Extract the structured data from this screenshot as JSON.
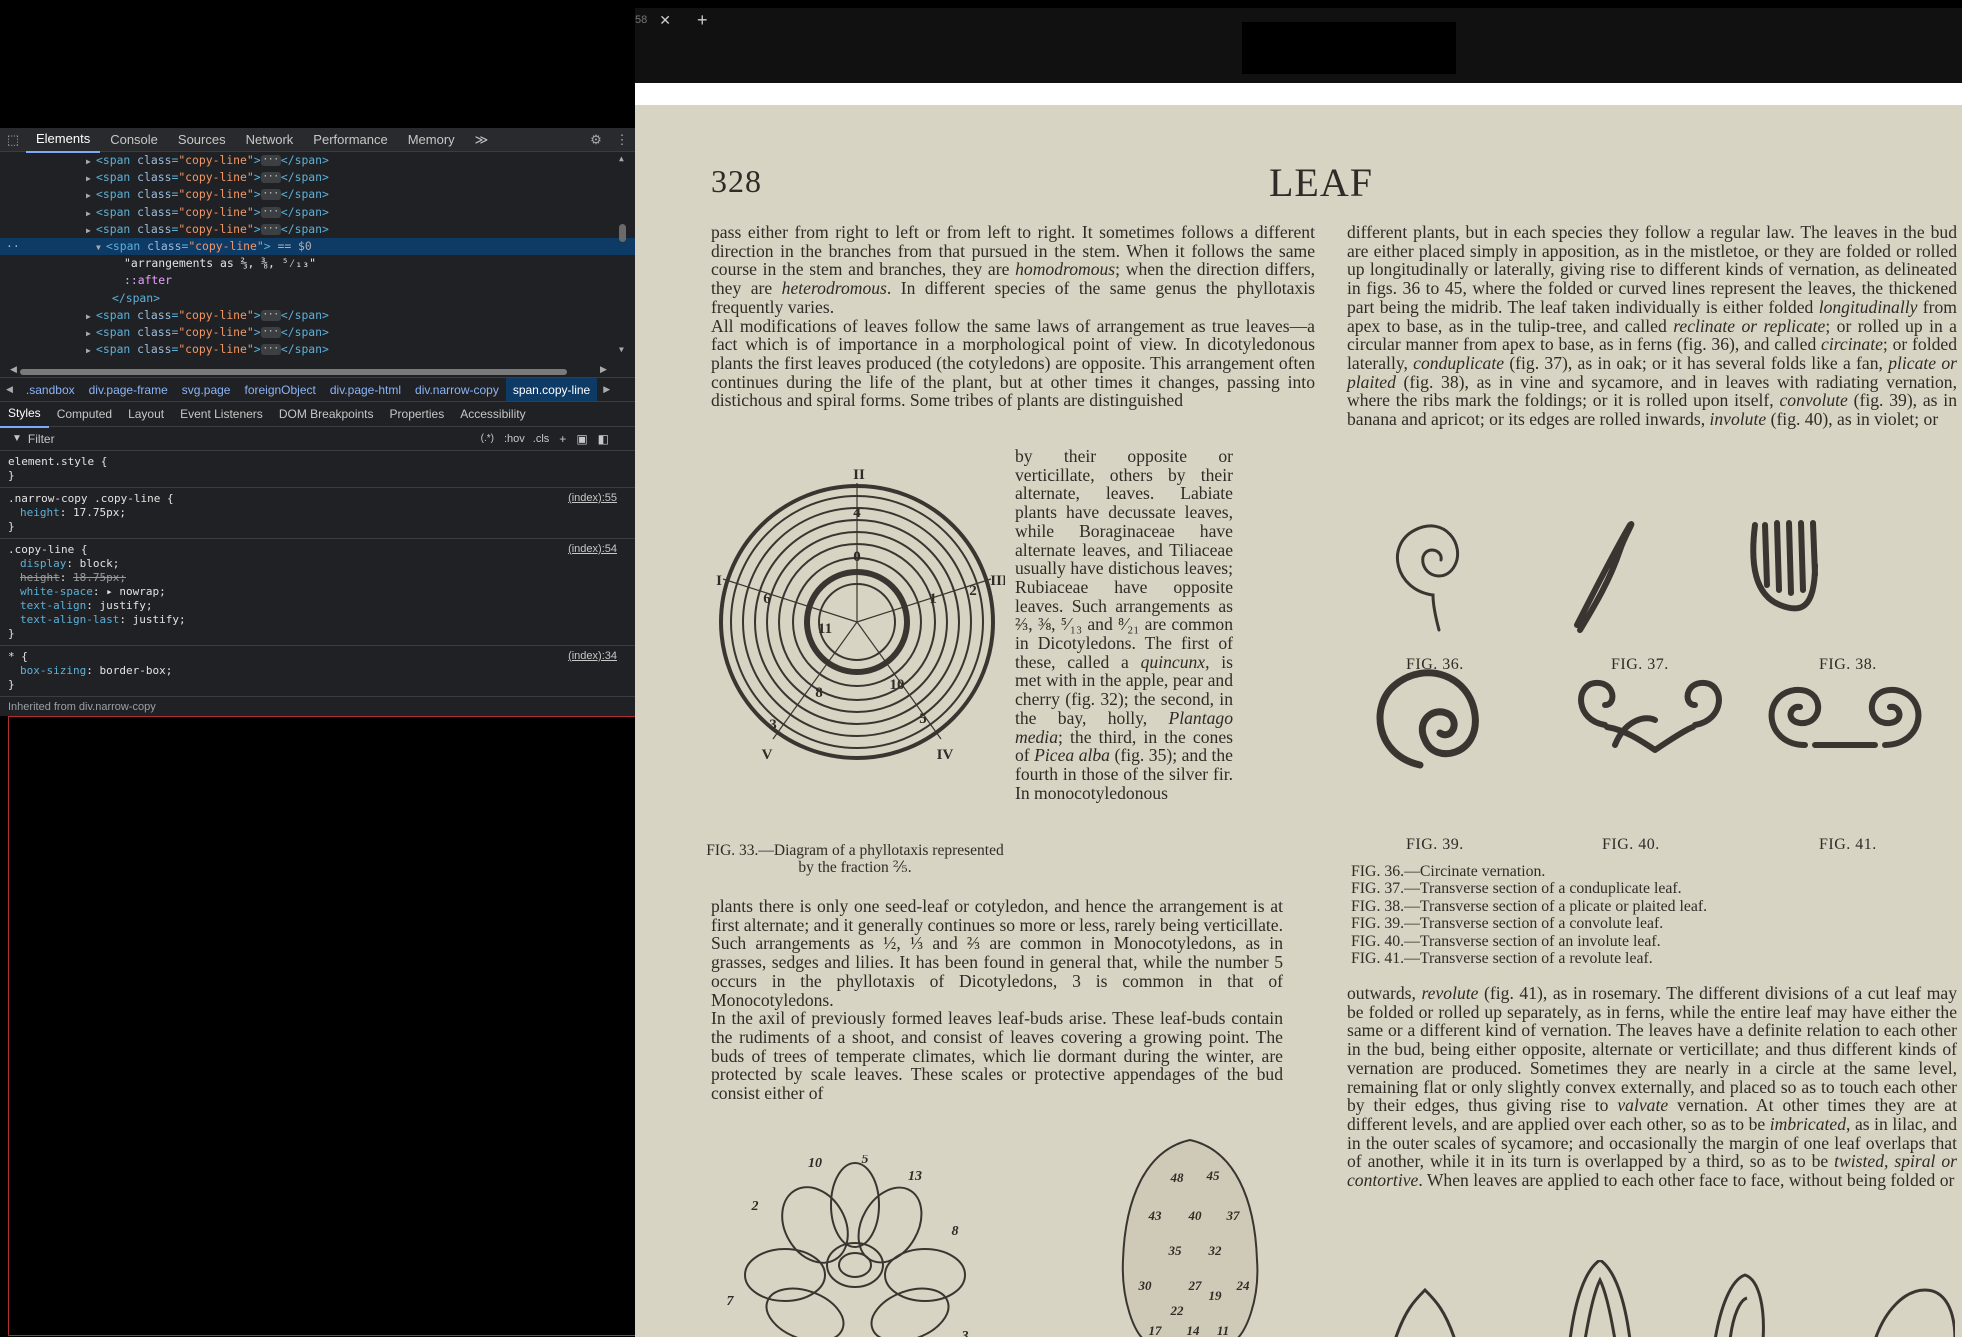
{
  "devtools": {
    "tabs": [
      "Elements",
      "Console",
      "Sources",
      "Network",
      "Performance",
      "Memory"
    ],
    "more_tabs": "≫",
    "dom_lines": [
      {
        "kind": "collapsed",
        "open": "<span class=\"copy-line\">",
        "close": "</span>"
      },
      {
        "kind": "collapsed",
        "open": "<span class=\"copy-line\">",
        "close": "</span>"
      },
      {
        "kind": "collapsed",
        "open": "<span class=\"copy-line\">",
        "close": "</span>"
      },
      {
        "kind": "collapsed",
        "open": "<span class=\"copy-line\">",
        "close": "</span>"
      },
      {
        "kind": "collapsed",
        "open": "<span class=\"copy-line\">",
        "close": "</span>"
      }
    ],
    "selected_line": {
      "tag": "span",
      "attr": "class",
      "value": "copy-line",
      "marker": "== $0"
    },
    "selected_text": "\"arrangements as ⅔, ⅜, ⁵⁄₁₃\"",
    "after_pseudo": "::after",
    "close_span": "</span>",
    "tag_name": "span",
    "attr_name": "class",
    "attr_value": "copy-line",
    "breadcrumbs": [
      ".sandbox",
      "div.page-frame",
      "svg.page",
      "foreignObject",
      "div.page-html",
      "div.narrow-copy",
      "span.copy-line"
    ],
    "subtabs": [
      "Styles",
      "Computed",
      "Layout",
      "Event Listeners",
      "DOM Breakpoints",
      "Properties",
      "Accessibility"
    ],
    "filter_placeholder": "Filter",
    "filter_tools": [
      ":hov",
      ".cls"
    ],
    "rules": [
      {
        "selector": "element.style {",
        "source": "",
        "props": []
      },
      {
        "selector": ".narrow-copy .copy-line {",
        "source": "(index):55",
        "props": [
          {
            "name": "height",
            "value": "17.75px;",
            "struck": false
          }
        ]
      },
      {
        "selector": ".copy-line {",
        "source": "(index):54",
        "props": [
          {
            "name": "display",
            "value": "block;",
            "struck": false
          },
          {
            "name": "height",
            "value": "18.75px;",
            "struck": true
          },
          {
            "name": "white-space",
            "value": "▸ nowrap;",
            "struck": false
          },
          {
            "name": "text-align",
            "value": "justify;",
            "struck": false
          },
          {
            "name": "text-align-last",
            "value": "justify;",
            "struck": false
          }
        ]
      },
      {
        "selector": "* {",
        "source": "(index):34",
        "props": [
          {
            "name": "box-sizing",
            "value": "border-box;",
            "struck": false
          }
        ]
      }
    ],
    "inherited_text": "Inherited from div.narrow-copy"
  },
  "browser": {
    "tab_fragment": "58",
    "close_glyph": "✕",
    "new_tab_glyph": "+"
  },
  "page": {
    "number": "328",
    "title": "LEAF",
    "left_col_1": [
      "pass either from right to left or from left to right. It sometimes follows a different direction in the branches from that pursued in the stem. When it follows the same course in the stem and branches, they are <i>homodromous</i>; when the direction differs, they are <i>heterodromous</i>. In different species of the same genus the phyllotaxis frequently varies.",
      "All modifications of leaves follow the same laws of arrangement as true leaves—a fact which is of importance in a morphological point of view. In dicotyledonous plants the first leaves produced (the cotyledons) are opposite. This arrangement often continues during the life of the plant, but at other times it changes, passing into distichous and spiral forms. Some tribes of plants are distinguished"
    ],
    "narrow_col": "by their opposite or verticillate, others by their alternate, leaves. Labiate plants have decussate leaves, while Boraginaceae have alternate leaves, and Tiliaceae usually have distichous leaves; Rubiaceae have opposite leaves. Such arrangements as ⅔, ⅜, ⁵⁄₁₃ and ⁸⁄₂₁ are common in Dicotyledons. The first of these, called a <i>quincunx</i>, is met with in the apple, pear and cherry (fig. 32); the second, in the bay, holly, <i>Plantago media</i>; the third, in the cones of <i>Picea alba</i> (fig. 35); and the fourth in those of the silver fir. In monocotyledonous",
    "fig33_caption": "FIG. 33.—Diagram of a phyllotaxis represented by the fraction ⅖.",
    "left_col_2": [
      "plants there is only one seed-leaf or cotyledon, and hence the arrangement is at first alternate; and it generally continues so more or less, rarely being verticillate. Such arrangements as ½, ⅓ and ⅔ are common in Monocotyledons, as in grasses, sedges and lilies. It has been found in general that, while the number 5 occurs in the phyllotaxis of Dicotyledons, 3 is common in that of Monocotyledons.",
      "In the axil of previously formed leaves leaf-buds arise. These leaf-buds contain the rudiments of a shoot, and consist of leaves covering a growing point. The buds of trees of temperate climates, which lie dormant during the winter, are protected by scale leaves. These scales or protective appendages of the bud consist either of"
    ],
    "right_col_1": "different plants, but in each species they follow a regular law. The leaves in the bud are either placed simply in apposition, as in the mistletoe, or they are folded or rolled up longitudinally or laterally, giving rise to different kinds of vernation, as delineated in figs. 36 to 45, where the folded or curved lines represent the leaves, the thickened part being the midrib. The leaf taken individually is either folded <i>longitudinally</i> from apex to base, as in the tulip-tree, and called <i>reclinate or replicate</i>; or rolled up in a circular manner from apex to base, as in ferns (fig. 36), and called <i>circinate</i>; or folded laterally, <i>conduplicate</i> (fig. 37), as in oak; or it has several folds like a fan, <i>plicate or plaited</i> (fig. 38), as in vine and sycamore, and in leaves with radiating vernation, where the ribs mark the foldings; or it is rolled upon itself, <i>convolute</i> (fig. 39), as in banana and apricot; or its edges are rolled inwards, <i>involute</i> (fig. 40), as in violet; or",
    "fig_labels": [
      "FIG. 36.",
      "FIG. 37.",
      "FIG. 38.",
      "FIG. 39.",
      "FIG. 40.",
      "FIG. 41."
    ],
    "fig_list": [
      "FIG. 36.—Circinate vernation.",
      "FIG. 37.—Transverse section of a conduplicate leaf.",
      "FIG. 38.—Transverse section of a plicate or plaited leaf.",
      "FIG. 39.—Transverse section of a convolute leaf.",
      "FIG. 40.—Transverse section of an involute leaf.",
      "FIG. 41.—Transverse section of a revolute leaf."
    ],
    "right_col_2": "outwards, <i>revolute</i> (fig. 41), as in rosemary. The different divisions of a cut leaf may be folded or rolled up separately, as in ferns, while the entire leaf may have either the same or a different kind of vernation. The leaves have a definite relation to each other in the bud, being either opposite, alternate or verticillate; and thus different kinds of vernation are produced. Sometimes they are nearly in a circle at the same level, remaining flat or only slightly convex externally, and placed so as to touch each other by their edges, thus giving rise to <i>valvate</i> vernation. At other times they are at different levels, and are applied over each other, so as to be <i>imbricated</i>, as in lilac, and in the outer scales of sycamore; and occasionally the margin of one leaf overlaps that of another, while it in its turn is overlapped by a third, so as to be <i>twisted, spiral or contortive</i>. When leaves are applied to each other face to face, without being folded or",
    "diagram_numerals": [
      "I",
      "II",
      "III",
      "IV",
      "V"
    ],
    "diagram_numbers": [
      "0",
      "4",
      "2",
      "8",
      "10",
      "5",
      "3",
      "6",
      "1",
      "11"
    ],
    "rosette_numbers": [
      "10",
      "5",
      "13",
      "2",
      "8",
      "7",
      "3"
    ],
    "cone_numbers": [
      "48",
      "45",
      "43",
      "40",
      "37",
      "35",
      "32",
      "27",
      "30",
      "22",
      "19",
      "24",
      "17",
      "14",
      "11"
    ]
  }
}
